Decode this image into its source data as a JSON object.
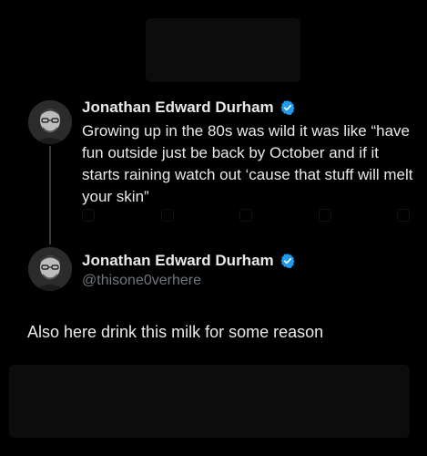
{
  "colors": {
    "background": "#000000",
    "text": "#e7e9ea",
    "muted": "#71767b",
    "verified": "#1d9bf0",
    "thread_line": "#3a3b3d"
  },
  "icons": {
    "verified": "verified-badge-icon",
    "avatar": "profile-avatar"
  },
  "original_tweet": {
    "display_name": "Jonathan Edward Durham",
    "text": "Growing up in the 80s was wild it was like “have fun outside just be back by October and if it starts raining watch out ‘cause that stuff will melt your skin”"
  },
  "reply_tweet": {
    "display_name": "Jonathan Edward Durham",
    "handle": "@thisone0verhere",
    "text": "Also here drink this milk for some reason"
  }
}
